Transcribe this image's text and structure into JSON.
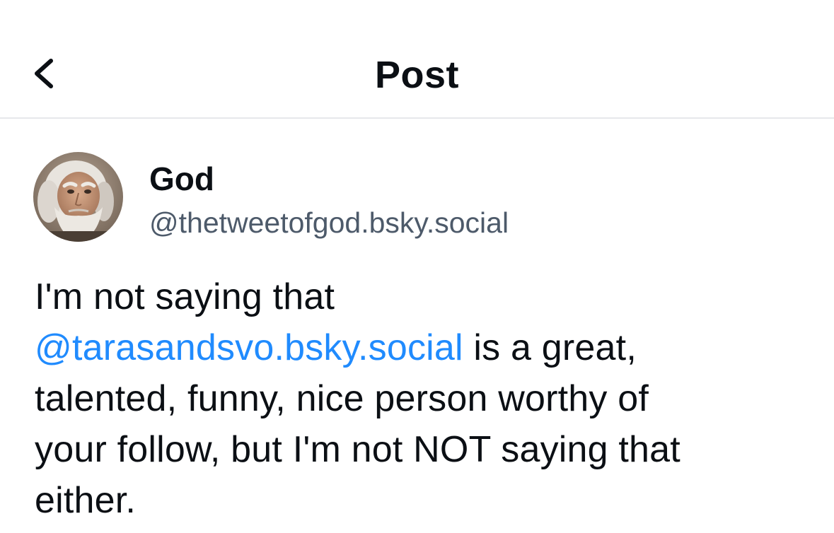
{
  "header": {
    "title": "Post",
    "back_icon": "chevron-left-icon"
  },
  "author": {
    "display_name": "God",
    "handle": "@thetweetofgod.bsky.social",
    "avatar": "avatar-portrait-bearded-man"
  },
  "post": {
    "line1": "I'm not saying that",
    "mention": "@tarasandsvo.bsky.social",
    "line2_rest": " is a great,",
    "line3": "talented, funny, nice person worthy of",
    "line4": "your follow, but I'm not NOT saying that",
    "line5": "either."
  },
  "colors": {
    "text": "#0b0f14",
    "handle": "#4d5a6a",
    "link": "#208bfe",
    "divider": "#e6e8eb",
    "background": "#ffffff"
  }
}
